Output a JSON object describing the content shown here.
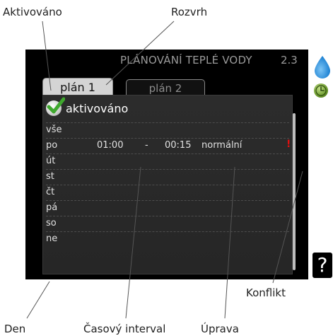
{
  "annotations": {
    "activated": "Aktivováno",
    "schedule": "Rozvrh",
    "conflict": "Konflikt",
    "day": "Den",
    "interval": "Časový interval",
    "adjustment": "Úprava"
  },
  "screen": {
    "title": "PLÁNOVÁNÍ TEPLÉ VODY",
    "number": "2.3"
  },
  "tabs": [
    {
      "label": "plán 1",
      "active": true
    },
    {
      "label": "plán 2",
      "active": false
    }
  ],
  "activated_label": "aktivováno",
  "rows": [
    {
      "day": "vše"
    },
    {
      "day": "po",
      "from": "01:00",
      "dash": "-",
      "to": "00:15",
      "mode": "normální",
      "conflict": "!"
    },
    {
      "day": "út"
    },
    {
      "day": "st"
    },
    {
      "day": "čt"
    },
    {
      "day": "pá"
    },
    {
      "day": "so"
    },
    {
      "day": "ne"
    }
  ],
  "icons": {
    "drop": "water-drop-icon",
    "clock": "clock-icon",
    "help": "?"
  },
  "colors": {
    "accent_blue": "#1a7fd1",
    "conflict_red": "#e01010",
    "check_green": "#3fa82e"
  }
}
